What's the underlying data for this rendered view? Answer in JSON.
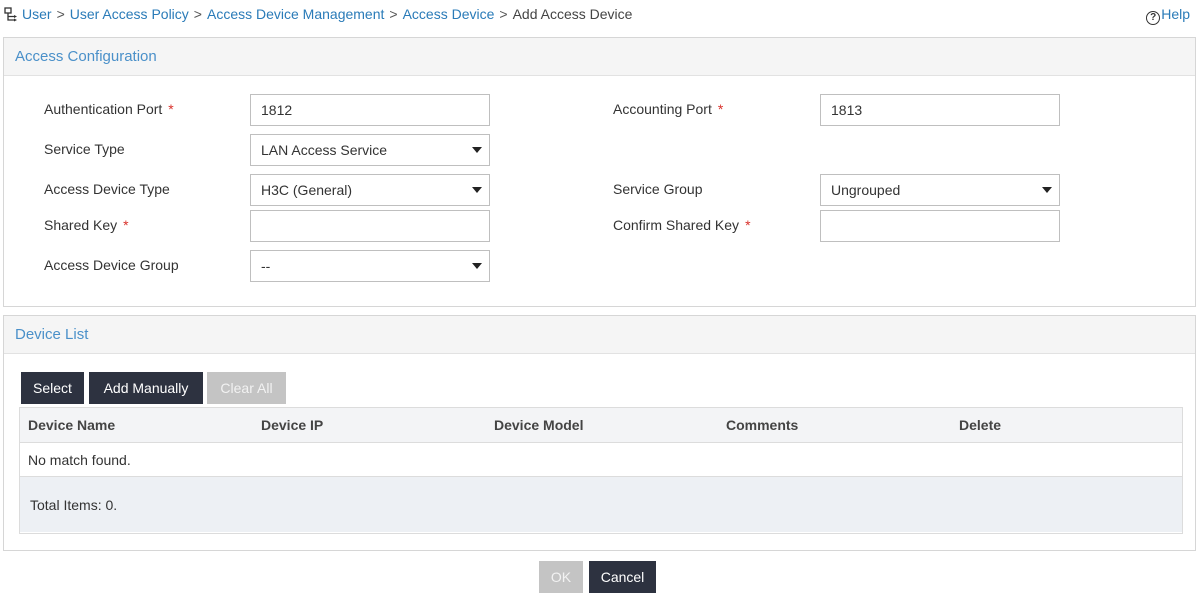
{
  "breadcrumb": {
    "items": [
      "User",
      "User Access Policy",
      "Access Device Management",
      "Access Device"
    ],
    "current": "Add Access Device",
    "separator": ">"
  },
  "help": {
    "label": "Help"
  },
  "access_config": {
    "title": "Access Configuration",
    "auth_port": {
      "label": "Authentication Port",
      "value": "1812"
    },
    "acct_port": {
      "label": "Accounting Port",
      "value": "1813"
    },
    "service_type": {
      "label": "Service Type",
      "value": "LAN Access Service"
    },
    "device_type": {
      "label": "Access Device Type",
      "value": "H3C (General)"
    },
    "service_group": {
      "label": "Service Group",
      "value": "Ungrouped"
    },
    "shared_key": {
      "label": "Shared Key",
      "value": ""
    },
    "confirm_key": {
      "label": "Confirm Shared Key",
      "value": ""
    },
    "device_group": {
      "label": "Access Device Group",
      "value": "--"
    },
    "required_mark": "*"
  },
  "device_list": {
    "title": "Device List",
    "buttons": {
      "select": "Select",
      "add_manually": "Add Manually",
      "clear_all": "Clear All"
    },
    "columns": [
      "Device Name",
      "Device IP",
      "Device Model",
      "Comments",
      "Delete"
    ],
    "empty_text": "No match found.",
    "total_text": "Total Items: 0."
  },
  "footer": {
    "ok": "OK",
    "cancel": "Cancel"
  },
  "colors": {
    "link": "#2a7bb8",
    "panel_title": "#4a90c9",
    "required": "#d9312b",
    "dark_button": "#2d3240",
    "disabled_button": "#c4c4c4"
  }
}
